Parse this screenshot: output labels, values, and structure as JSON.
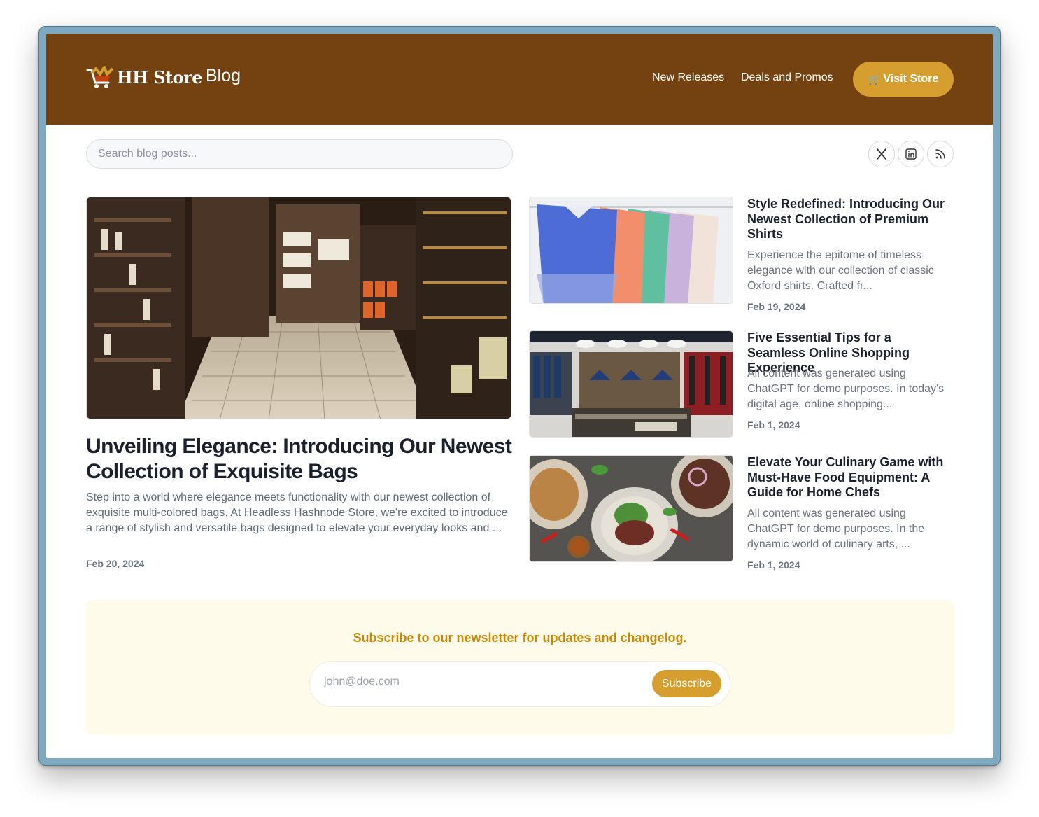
{
  "header": {
    "logo_text": "HH Store",
    "blog_label": "Blog",
    "nav": [
      "New Releases",
      "Deals and Promos"
    ],
    "visit_store": {
      "icon": "cart-icon",
      "label": "Visit Store"
    }
  },
  "search": {
    "placeholder": "Search blog posts..."
  },
  "social": [
    "x-icon",
    "linkedin-icon",
    "rss-icon"
  ],
  "colors": {
    "header_bg": "#744210",
    "accent": "#d69e2e",
    "newsletter_bg": "#fffbea",
    "newsletter_text": "#c98a0c"
  },
  "featured": {
    "title": "Unveiling Elegance: Introducing Our Newest Collection of Exquisite Bags",
    "excerpt": "Step into a world where elegance meets functionality with our newest collection of exquisite multi-colored bags. At Headless Hashnode Store, we're excited to introduce a range of stylish and versatile bags designed to elevate your everyday looks and ...",
    "date": "Feb 20, 2024"
  },
  "posts": [
    {
      "title": "Style Redefined: Introducing Our Newest Collection of Premium Shirts",
      "excerpt": "Experience the epitome of timeless elegance with our collection of classic Oxford shirts. Crafted fr...",
      "date": "Feb 19, 2024"
    },
    {
      "title": "Five Essential Tips for a Seamless Online Shopping Experience",
      "excerpt": "All content was generated using ChatGPT for demo purposes. In today's digital age, online shopping...",
      "date": "Feb 1, 2024"
    },
    {
      "title": "Elevate Your Culinary Game with Must-Have Food Equipment: A Guide for Home Chefs",
      "excerpt": "All content was generated using ChatGPT for demo purposes. In the dynamic world of culinary arts, ...",
      "date": "Feb 1, 2024"
    }
  ],
  "newsletter": {
    "heading": "Subscribe to our newsletter for updates and changelog.",
    "placeholder": "john@doe.com",
    "button": "Subscribe"
  }
}
